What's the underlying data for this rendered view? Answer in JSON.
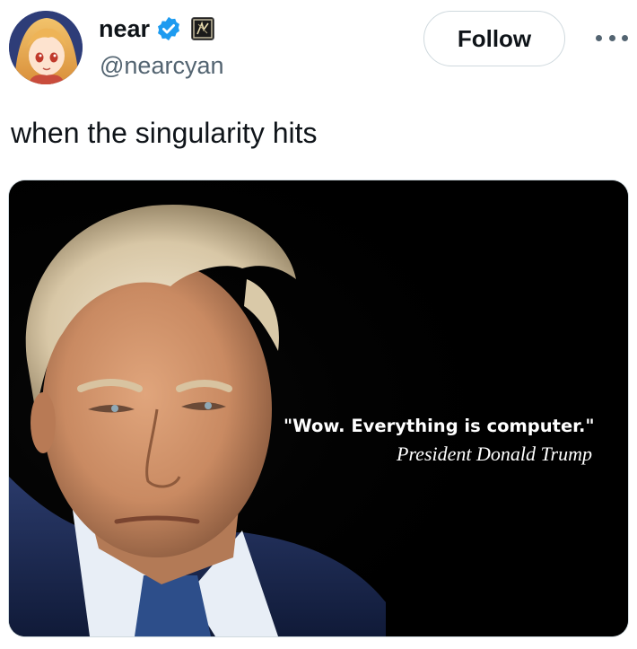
{
  "author": {
    "display_name": "near",
    "handle": "@nearcyan",
    "avatar_icon": "anime-avatar-icon",
    "verified_icon": "verified-badge-icon",
    "affiliate_icon": "affiliate-badge-icon"
  },
  "actions": {
    "follow_label": "Follow",
    "more_icon": "more-options-icon"
  },
  "tweet": {
    "text": "when the singularity hits"
  },
  "media": {
    "quote": "\"Wow. Everything is computer.\"",
    "attribution": "President Donald Trump",
    "background_color": "#000000"
  },
  "colors": {
    "primary_text": "#0f1419",
    "secondary_text": "#536471",
    "verified_blue": "#1d9bf0",
    "border": "#cfd9de"
  }
}
